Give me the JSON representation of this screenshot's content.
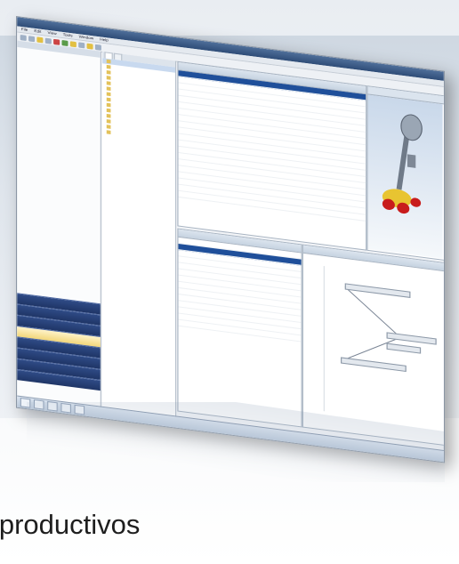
{
  "window": {
    "title": "",
    "menu": [
      "File",
      "Edit",
      "View",
      "Tools",
      "Window",
      "Help"
    ],
    "left_panel": {
      "header": "",
      "items": [
        "",
        "",
        "",
        ""
      ],
      "nav": [
        "",
        "",
        "",
        "",
        "",
        "",
        "",
        ""
      ]
    },
    "tree": {
      "tabs": [
        "",
        ""
      ],
      "rows": [
        "",
        "",
        "",
        "",
        "",
        "",
        "",
        "",
        "",
        "",
        "",
        "",
        "",
        ""
      ]
    },
    "bom": {
      "header": "",
      "rows": [
        "",
        "",
        "",
        "",
        "",
        "",
        "",
        "",
        "",
        "",
        "",
        "",
        "",
        "",
        "",
        "",
        "",
        "",
        "",
        ""
      ]
    },
    "viewer": {
      "header": ""
    },
    "process": {
      "header": "",
      "nodes": [
        "",
        "",
        "",
        ""
      ]
    },
    "taskbar": [
      "",
      "",
      "",
      "",
      ""
    ]
  },
  "caption": {
    "text": "sos productivos"
  }
}
